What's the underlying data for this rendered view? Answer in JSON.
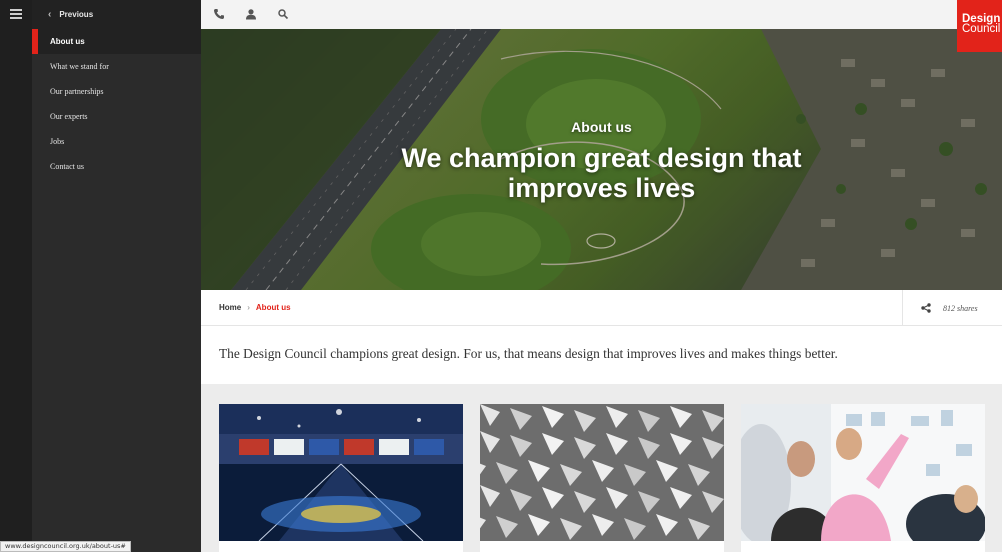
{
  "sidebar": {
    "previous_label": "Previous",
    "items": [
      {
        "label": "About us",
        "active": true
      },
      {
        "label": "What we stand for",
        "active": false
      },
      {
        "label": "Our partnerships",
        "active": false
      },
      {
        "label": "Our experts",
        "active": false
      },
      {
        "label": "Jobs",
        "active": false
      },
      {
        "label": "Contact us",
        "active": false
      }
    ]
  },
  "topbar": {
    "icons": [
      "phone-icon",
      "user-icon",
      "search-icon"
    ]
  },
  "logo": {
    "line1": "Design",
    "line2": "Council",
    "color": "#e2231a"
  },
  "hero": {
    "subtitle": "About us",
    "title": "We champion great design that improves lives"
  },
  "breadcrumb": {
    "home": "Home",
    "separator": "›",
    "current": "About us"
  },
  "shares": {
    "count_label": "812 shares",
    "icon": "share-icon"
  },
  "intro": {
    "text": "The Design Council champions great design. For us, that means design that improves lives and makes things better."
  },
  "cards": [
    {
      "image": "stadium-ceremony-photo"
    },
    {
      "image": "geometric-pattern-photo"
    },
    {
      "image": "people-at-whiteboard-photo"
    }
  ],
  "status_bar": {
    "url": "www.designcouncil.org.uk/about-us#"
  },
  "colors": {
    "accent": "#e2231a",
    "sidebar_bg": "#2b2b2b",
    "rail_bg": "#1f1f1f"
  }
}
